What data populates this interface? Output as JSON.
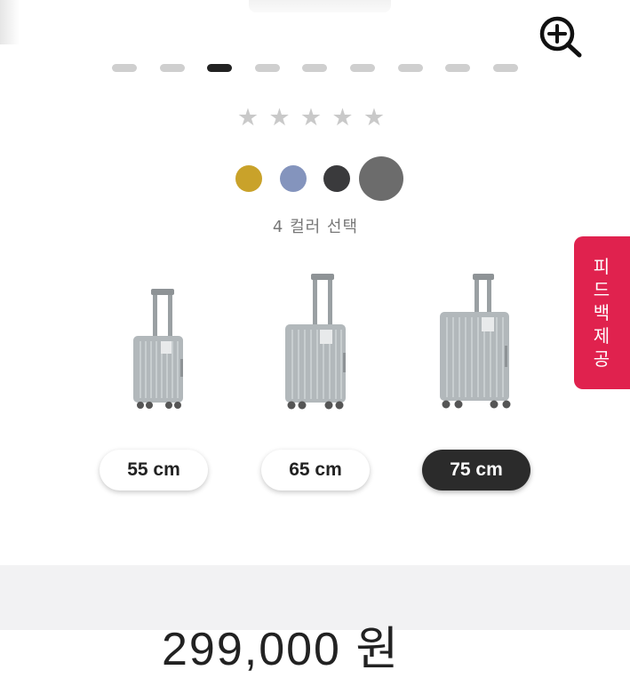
{
  "gallery": {
    "zoom_icon": "zoom-in-icon",
    "page_count": 9,
    "active_page_index": 2
  },
  "rating": {
    "stars_total": 5,
    "stars_filled": 0,
    "star_color": "#c9c9c9"
  },
  "colors": {
    "options": [
      {
        "name": "mustard",
        "hex": "#c9a22a"
      },
      {
        "name": "blue-grey",
        "hex": "#8494bd"
      },
      {
        "name": "charcoal",
        "hex": "#3a3a3c"
      },
      {
        "name": "grey",
        "hex": "#6c6c6c"
      }
    ],
    "selected_index": 3,
    "caption": "4 컬러 선택"
  },
  "sizes": {
    "options": [
      {
        "label": "55 cm",
        "selected": false
      },
      {
        "label": "65 cm",
        "selected": false
      },
      {
        "label": "75 cm",
        "selected": true
      }
    ]
  },
  "feedback": {
    "chars": [
      "피",
      "드",
      "백",
      "제",
      "공"
    ],
    "color": "#e0224e"
  },
  "price": {
    "text": "299,000 원"
  }
}
